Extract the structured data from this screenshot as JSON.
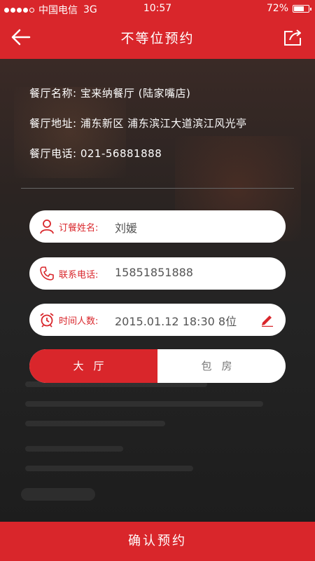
{
  "status_bar": {
    "carrier": "中国电信",
    "network": "3G",
    "time": "10:57",
    "battery": "72%",
    "battery_level": 0.72
  },
  "nav": {
    "title": "不等位预约",
    "back_icon": "back-arrow-icon",
    "share_icon": "share-icon"
  },
  "restaurant": {
    "name_label": "餐厅名称:",
    "name": "宝来纳餐厅 (陆家嘴店)",
    "address_label": "餐厅地址:",
    "address": "浦东新区 浦东滨江大道滨江风光亭",
    "phone_label": "餐厅电话:",
    "phone": "021-56881888"
  },
  "form": {
    "name_label": "订餐姓名:",
    "name_value": "刘媛",
    "phone_label": "联系电话:",
    "phone_value": "15851851888",
    "time_label": "时间人数:",
    "time_value": "2015.01.12  18:30  8位"
  },
  "room_type": {
    "options": [
      "大厅",
      "包房"
    ],
    "selected": "大厅"
  },
  "confirm_label": "确认预约",
  "colors": {
    "accent": "#d9262b"
  }
}
